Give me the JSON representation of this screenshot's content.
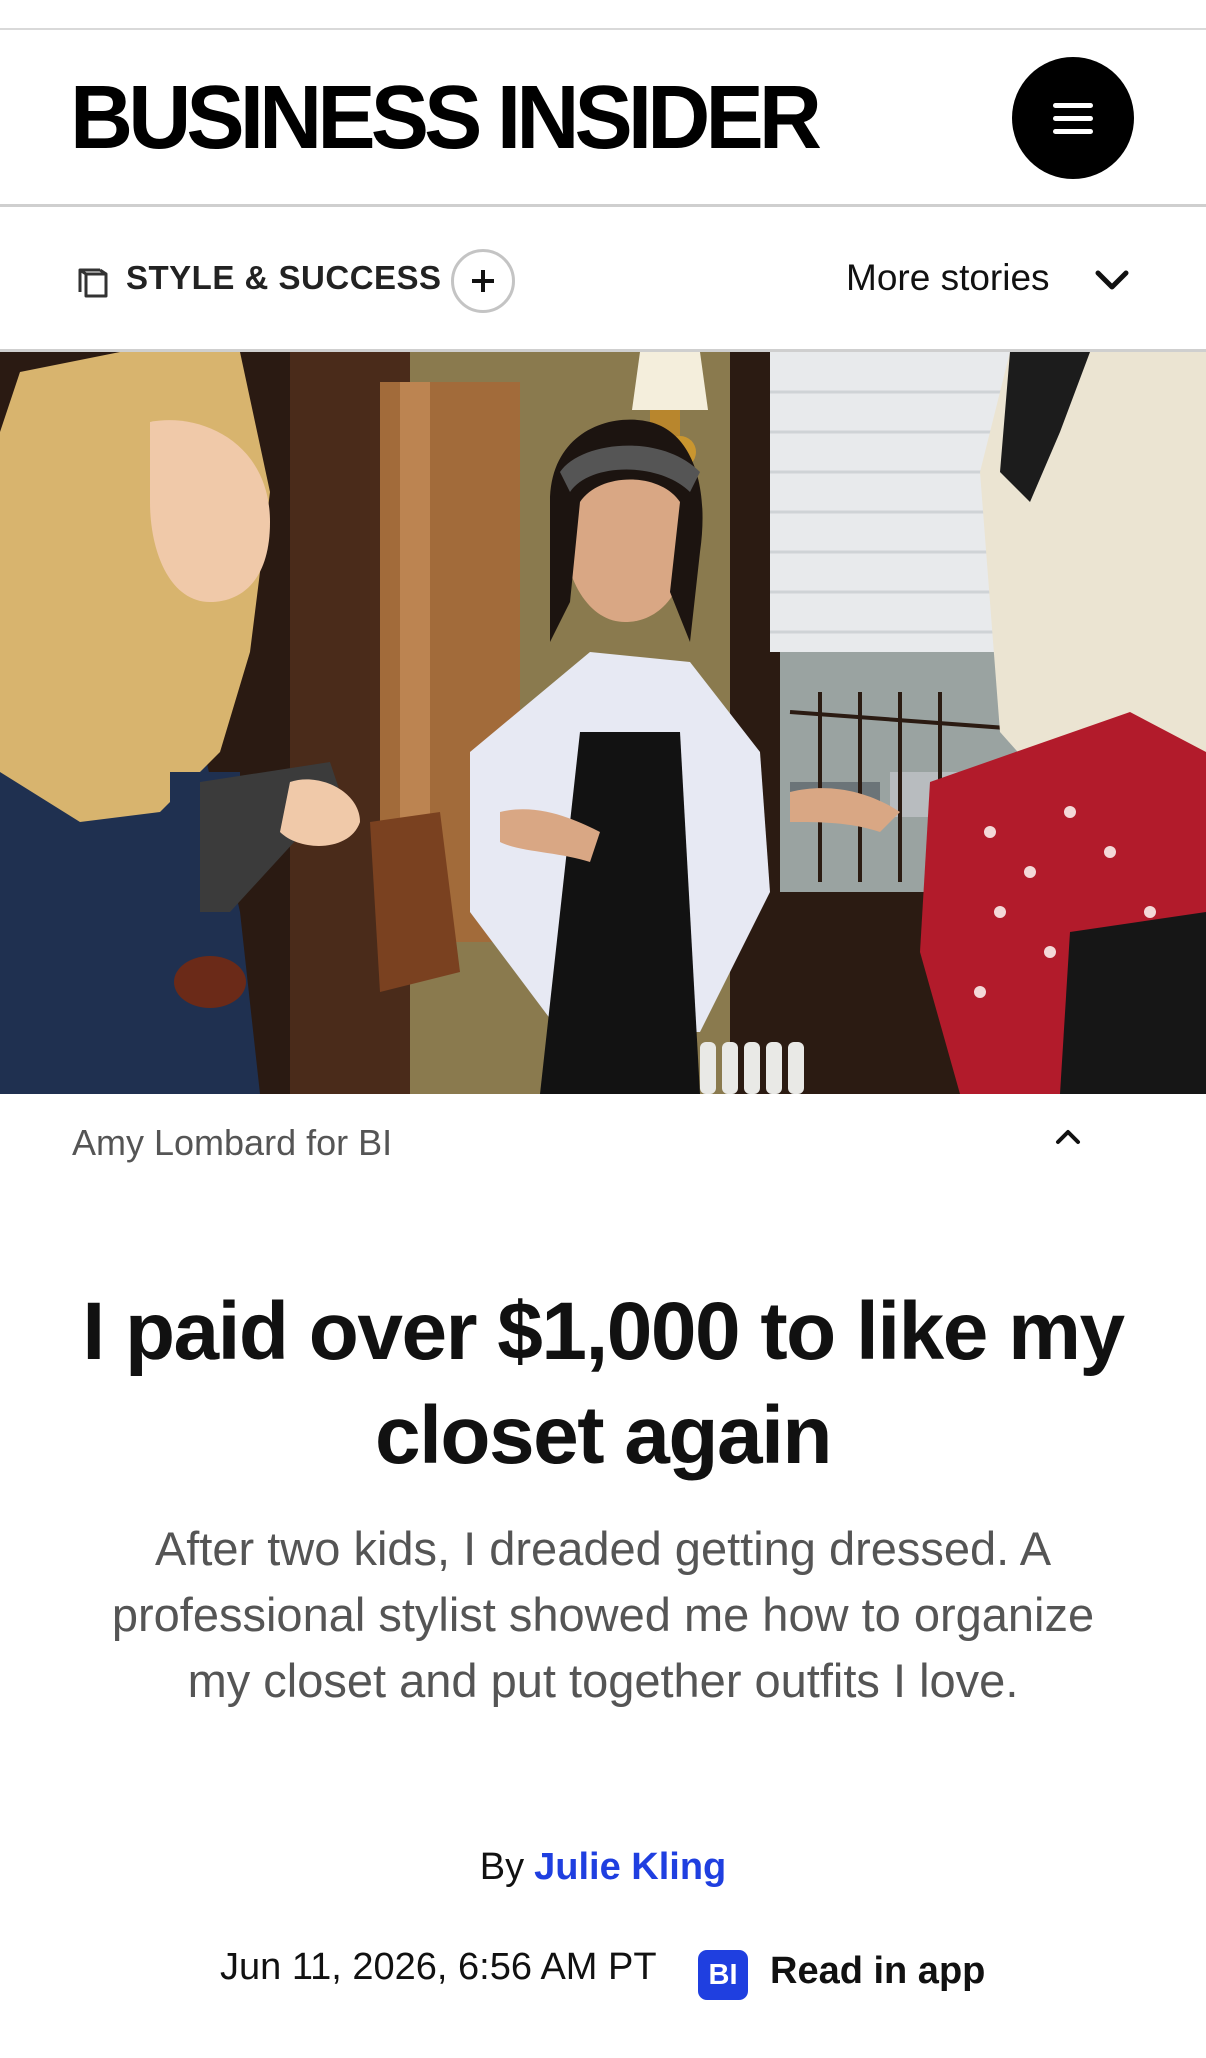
{
  "header": {
    "logo_text": "BUSINESS INSIDER",
    "menu_icon": "hamburger-menu-icon"
  },
  "section_bar": {
    "section_icon": "layers-icon",
    "section_label": "STYLE & SUCCESS",
    "follow_icon": "plus-icon",
    "more_stories_label": "More stories",
    "more_stories_icon": "chevron-down-icon"
  },
  "hero": {
    "caption_credit": "Amy Lombard for BI",
    "caption_toggle_icon": "chevron-up-icon"
  },
  "article": {
    "headline": "I paid over $1,000 to like my closet again",
    "dek": "After two kids, I dreaded getting dressed. A professional stylist showed me how to organize my closet and put together outfits I love.",
    "byline_prefix": "By",
    "author": "Julie Kling",
    "date": "Jun 11, 2026, 6:56 AM PT",
    "app_badge_text": "BI",
    "read_in_app": "Read in app"
  },
  "colors": {
    "link_blue": "#1f3fe0",
    "text_primary": "#111111",
    "text_secondary": "#555555",
    "divider": "#cfcfcf"
  }
}
